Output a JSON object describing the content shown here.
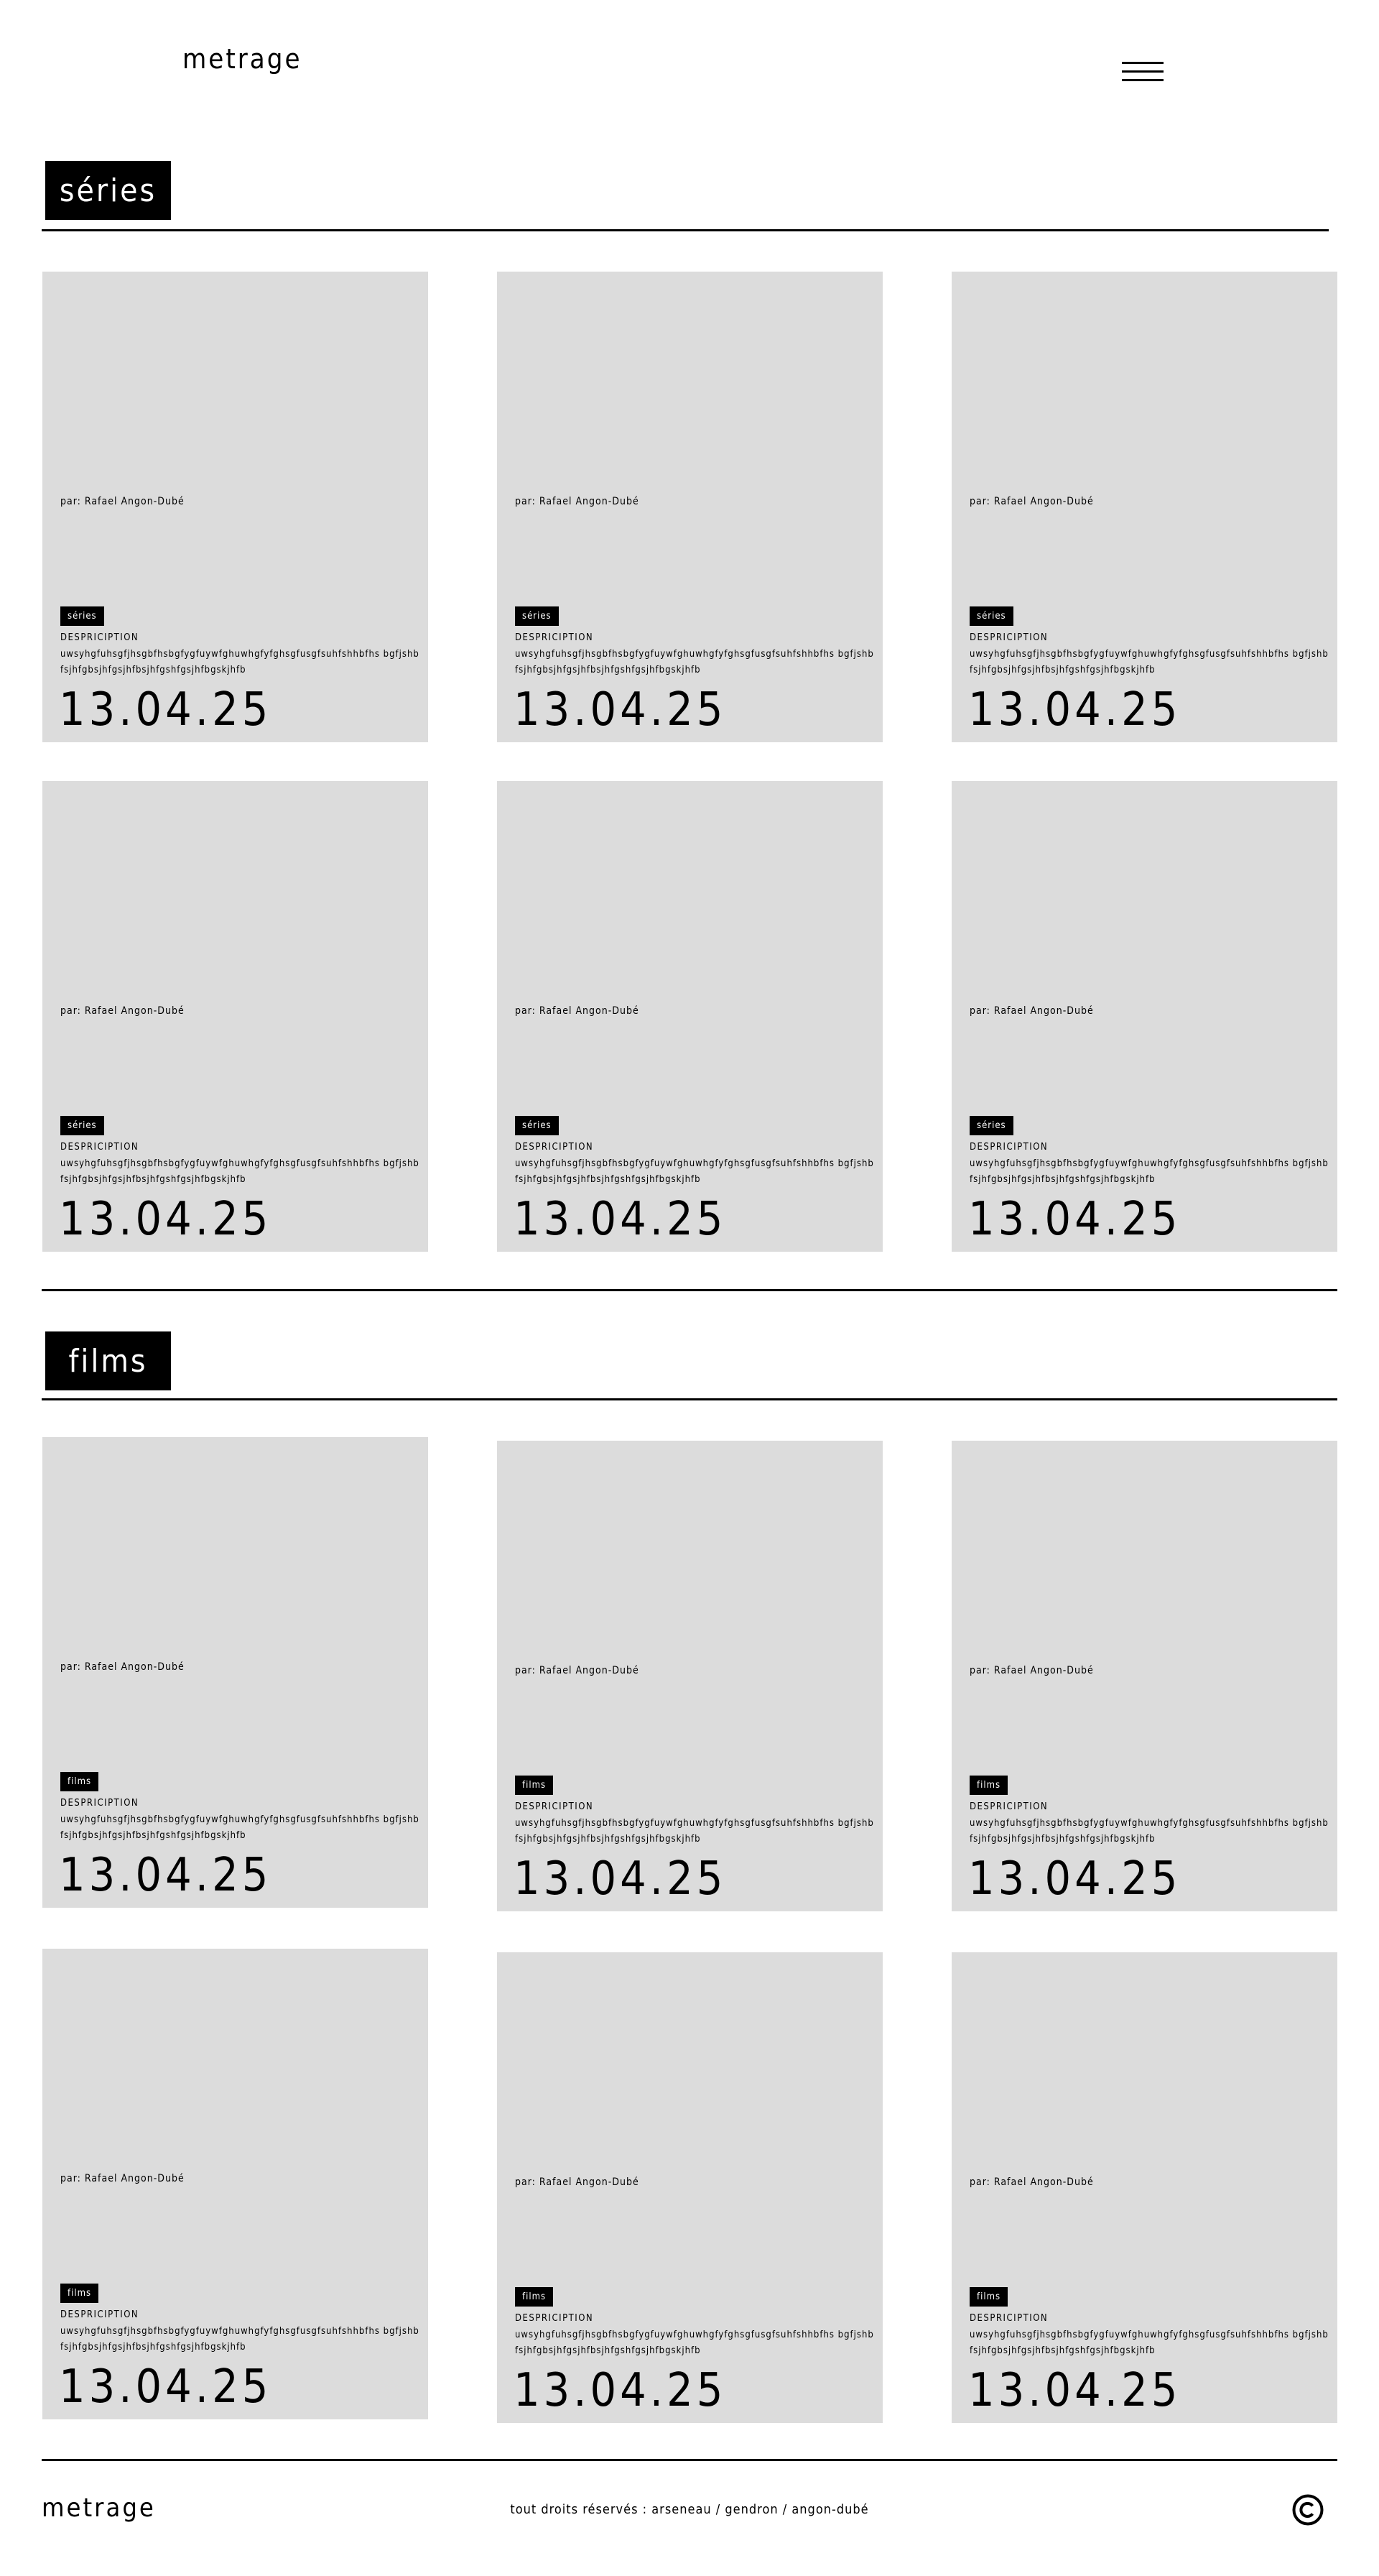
{
  "header": {
    "brand": "metrage",
    "menu_icon": "hamburger-menu-icon"
  },
  "series_section": {
    "title": "séries",
    "cards": [
      {
        "author": "par: Rafael Angon-Dubé",
        "tag": "séries",
        "desc_label": "DESPRICIPTION",
        "desc_text": "uwsyhgfuhsgfjhsgbfhsbgfygfuywfghuwhgfyfghsgfusgfsuhfshhbfhs bgfjshbfsjhfgbsjhfgsjhfbsjhfgshfgsjhfbgskjhfb",
        "date": "13.04.25"
      },
      {
        "author": "par: Rafael Angon-Dubé",
        "tag": "séries",
        "desc_label": "DESPRICIPTION",
        "desc_text": "uwsyhgfuhsgfjhsgbfhsbgfygfuywfghuwhgfyfghsgfusgfsuhfshhbfhs bgfjshbfsjhfgbsjhfgsjhfbsjhfgshfgsjhfbgskjhfb",
        "date": "13.04.25"
      },
      {
        "author": "par: Rafael Angon-Dubé",
        "tag": "séries",
        "desc_label": "DESPRICIPTION",
        "desc_text": "uwsyhgfuhsgfjhsgbfhsbgfygfuywfghuwhgfyfghsgfusgfsuhfshhbfhs bgfjshbfsjhfgbsjhfgsjhfbsjhfgshfgsjhfbgskjhfb",
        "date": "13.04.25"
      },
      {
        "author": "par: Rafael Angon-Dubé",
        "tag": "séries",
        "desc_label": "DESPRICIPTION",
        "desc_text": "uwsyhgfuhsgfjhsgbfhsbgfygfuywfghuwhgfyfghsgfusgfsuhfshhbfhs bgfjshbfsjhfgbsjhfgsjhfbsjhfgshfgsjhfbgskjhfb",
        "date": "13.04.25"
      },
      {
        "author": "par: Rafael Angon-Dubé",
        "tag": "séries",
        "desc_label": "DESPRICIPTION",
        "desc_text": "uwsyhgfuhsgfjhsgbfhsbgfygfuywfghuwhgfyfghsgfusgfsuhfshhbfhs bgfjshbfsjhfgbsjhfgsjhfbsjhfgshfgsjhfbgskjhfb",
        "date": "13.04.25"
      },
      {
        "author": "par: Rafael Angon-Dubé",
        "tag": "séries",
        "desc_label": "DESPRICIPTION",
        "desc_text": "uwsyhgfuhsgfjhsgbfhsbgfygfuywfghuwhgfyfghsgfusgfsuhfshhbfhs bgfjshbfsjhfgbsjhfgsjhfbsjhfgshfgsjhfbgskjhfb",
        "date": "13.04.25"
      }
    ]
  },
  "films_section": {
    "title": "films",
    "cards": [
      {
        "author": "par: Rafael Angon-Dubé",
        "tag": "films",
        "desc_label": "DESPRICIPTION",
        "desc_text": "uwsyhgfuhsgfjhsgbfhsbgfygfuywfghuwhgfyfghsgfusgfsuhfshhbfhs bgfjshbfsjhfgbsjhfgsjhfbsjhfgshfgsjhfbgskjhfb",
        "date": "13.04.25"
      },
      {
        "author": "par: Rafael Angon-Dubé",
        "tag": "films",
        "desc_label": "DESPRICIPTION",
        "desc_text": "uwsyhgfuhsgfjhsgbfhsbgfygfuywfghuwhgfyfghsgfusgfsuhfshhbfhs bgfjshbfsjhfgbsjhfgsjhfbsjhfgshfgsjhfbgskjhfb",
        "date": "13.04.25"
      },
      {
        "author": "par: Rafael Angon-Dubé",
        "tag": "films",
        "desc_label": "DESPRICIPTION",
        "desc_text": "uwsyhgfuhsgfjhsgbfhsbgfygfuywfghuwhgfyfghsgfusgfsuhfshhbfhs bgfjshbfsjhfgbsjhfgsjhfbsjhfgshfgsjhfbgskjhfb",
        "date": "13.04.25"
      },
      {
        "author": "par: Rafael Angon-Dubé",
        "tag": "films",
        "desc_label": "DESPRICIPTION",
        "desc_text": "uwsyhgfuhsgfjhsgbfhsbgfygfuywfghuwhgfyfghsgfusgfsuhfshhbfhs bgfjshbfsjhfgbsjhfgsjhfbsjhfgshfgsjhfbgskjhfb",
        "date": "13.04.25"
      },
      {
        "author": "par: Rafael Angon-Dubé",
        "tag": "films",
        "desc_label": "DESPRICIPTION",
        "desc_text": "uwsyhgfuhsgfjhsgbfhsbgfygfuywfghuwhgfyfghsgfusgfsuhfshhbfhs bgfjshbfsjhfgbsjhfgsjhfbsjhfgshfgsjhfbgskjhfb",
        "date": "13.04.25"
      },
      {
        "author": "par: Rafael Angon-Dubé",
        "tag": "films",
        "desc_label": "DESPRICIPTION",
        "desc_text": "uwsyhgfuhsgfjhsgbfhsbgfygfuywfghuwhgfyfghsgfusgfsuhfshhbfhs bgfjshbfsjhfgbsjhfgsjhfbsjhfgshfgsjhfbgskjhfb",
        "date": "13.04.25"
      }
    ]
  },
  "footer": {
    "brand": "metrage",
    "credits": "tout droits réservés : arseneau / gendron / angon-dubé",
    "copyright_icon": "copyright-icon"
  },
  "colors": {
    "card_bg": "#dcdcdc",
    "tag_bg": "#000000",
    "tag_text": "#ffffff",
    "page_bg": "#ffffff"
  }
}
